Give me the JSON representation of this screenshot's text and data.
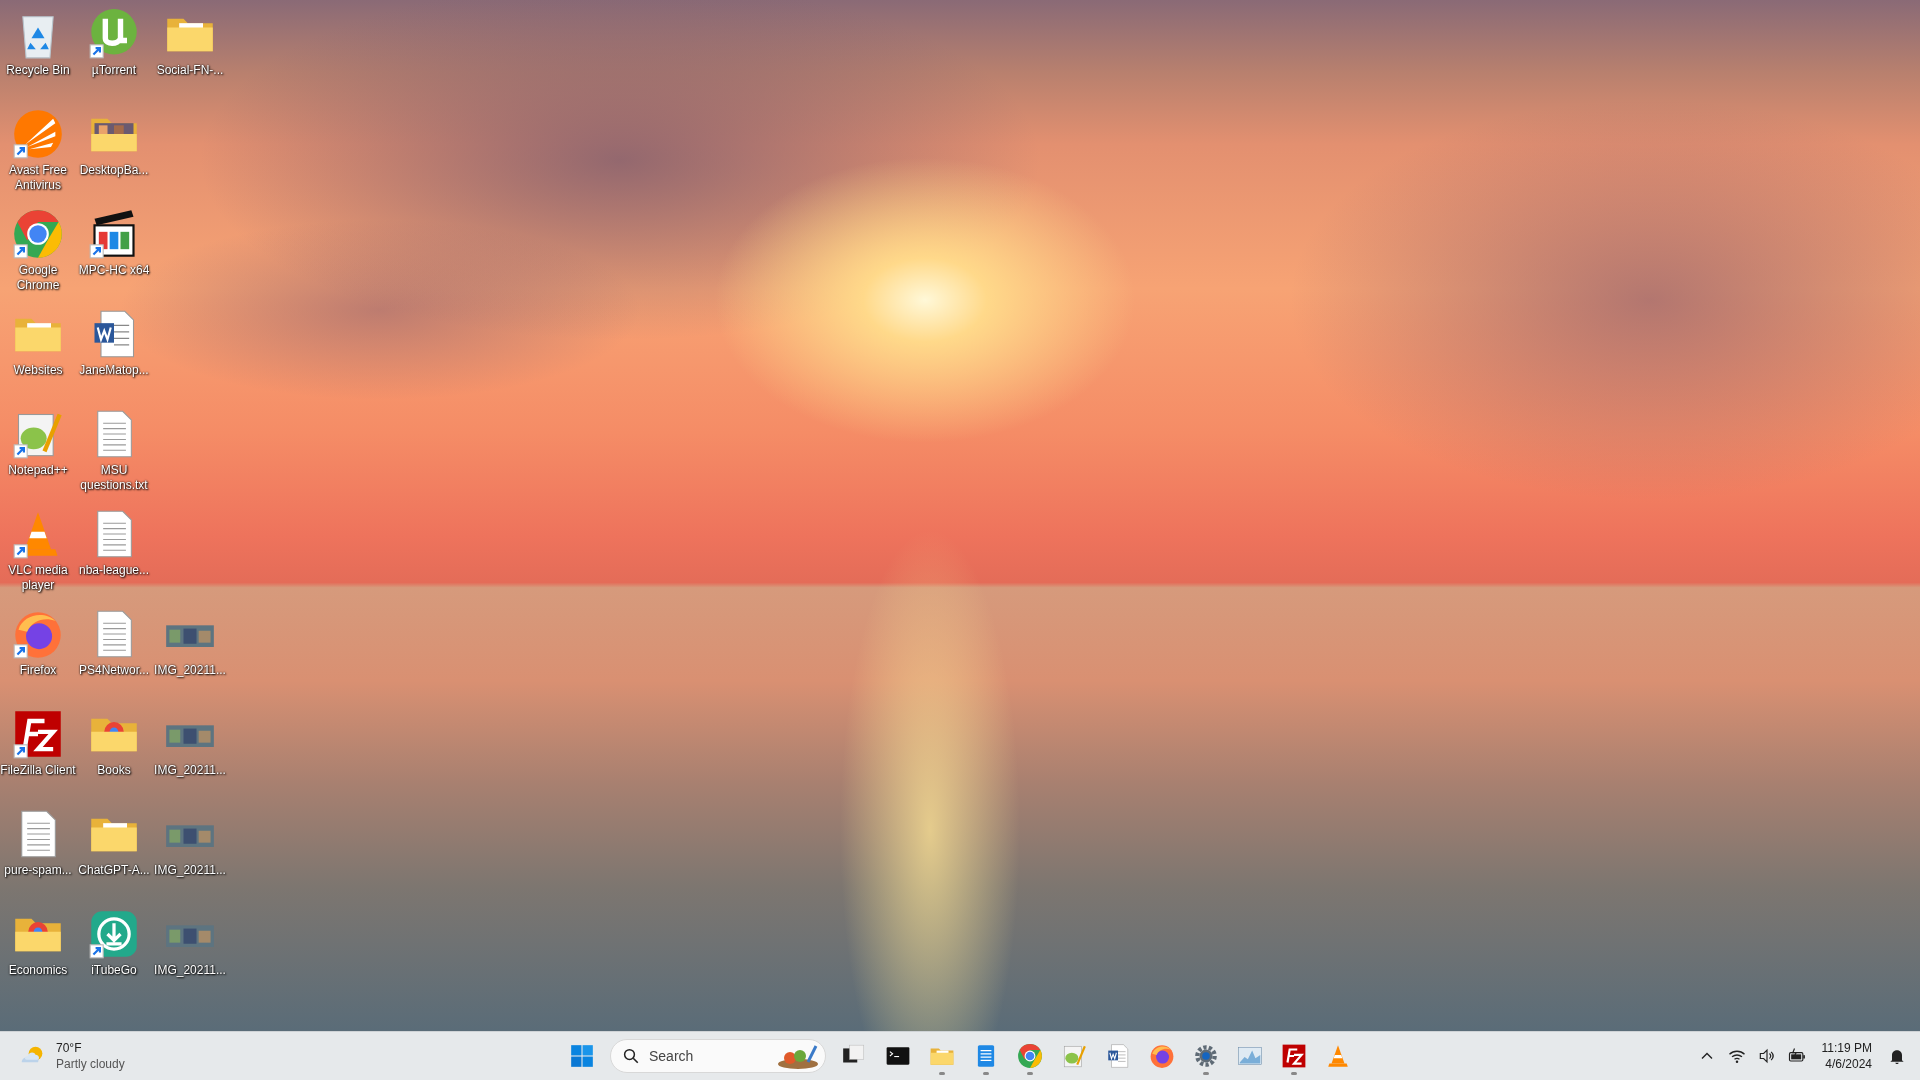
{
  "desktop": {
    "columns": [
      {
        "icons": [
          {
            "label": "Recycle Bin",
            "kind": "recycle",
            "shortcut": false
          },
          {
            "label": "Avast Free Antivirus",
            "kind": "avast",
            "shortcut": true
          },
          {
            "label": "Google Chrome",
            "kind": "chrome",
            "shortcut": true
          },
          {
            "label": "Websites",
            "kind": "folder",
            "shortcut": false
          },
          {
            "label": "Notepad++",
            "kind": "notepadpp",
            "shortcut": true
          },
          {
            "label": "VLC media player",
            "kind": "vlc",
            "shortcut": true
          },
          {
            "label": "Firefox",
            "kind": "firefox",
            "shortcut": true
          },
          {
            "label": "FileZilla Client",
            "kind": "filezilla",
            "shortcut": true
          },
          {
            "label": "pure-spam...",
            "kind": "text",
            "shortcut": false
          },
          {
            "label": "Economics",
            "kind": "folder-chrome",
            "shortcut": false
          }
        ]
      },
      {
        "icons": [
          {
            "label": "µTorrent",
            "kind": "torrent",
            "shortcut": true
          },
          {
            "label": "DesktopBa...",
            "kind": "folder-photo",
            "shortcut": false
          },
          {
            "label": "MPC-HC x64",
            "kind": "mpc",
            "shortcut": true
          },
          {
            "label": "JaneMatop...",
            "kind": "word",
            "shortcut": false
          },
          {
            "label": "MSU questions.txt",
            "kind": "text",
            "shortcut": false
          },
          {
            "label": "nba-league...",
            "kind": "text",
            "shortcut": false
          },
          {
            "label": "PS4Networ...",
            "kind": "text",
            "shortcut": false
          },
          {
            "label": "Books",
            "kind": "folder-chrome",
            "shortcut": false
          },
          {
            "label": "ChatGPT-A...",
            "kind": "folder",
            "shortcut": false
          },
          {
            "label": "iTubeGo",
            "kind": "itubego",
            "shortcut": true
          }
        ]
      },
      {
        "icons": [
          {
            "label": "Social-FN-...",
            "kind": "folder",
            "shortcut": false
          }
        ],
        "bottom_icons": [
          {
            "label": "IMG_20211...",
            "kind": "photo",
            "shortcut": false
          },
          {
            "label": "IMG_20211...",
            "kind": "photo",
            "shortcut": false
          },
          {
            "label": "IMG_20211...",
            "kind": "photo",
            "shortcut": false
          },
          {
            "label": "IMG_20211...",
            "kind": "photo",
            "shortcut": false
          }
        ]
      }
    ]
  },
  "taskbar": {
    "weather": {
      "temperature": "70°F",
      "condition": "Partly cloudy"
    },
    "search": {
      "placeholder": "Search"
    },
    "apps": [
      {
        "kind": "task-view",
        "running": false
      },
      {
        "kind": "terminal",
        "running": false
      },
      {
        "kind": "explorer",
        "running": true
      },
      {
        "kind": "notepad",
        "running": true
      },
      {
        "kind": "chrome",
        "running": true
      },
      {
        "kind": "notepadpp",
        "running": false
      },
      {
        "kind": "word",
        "running": false
      },
      {
        "kind": "firefox",
        "running": false
      },
      {
        "kind": "settings",
        "running": true
      },
      {
        "kind": "monitor",
        "running": false
      },
      {
        "kind": "filezilla",
        "running": true
      },
      {
        "kind": "vlc",
        "running": false
      }
    ],
    "tray": {
      "time": "11:19 PM",
      "date": "4/6/2024"
    }
  }
}
